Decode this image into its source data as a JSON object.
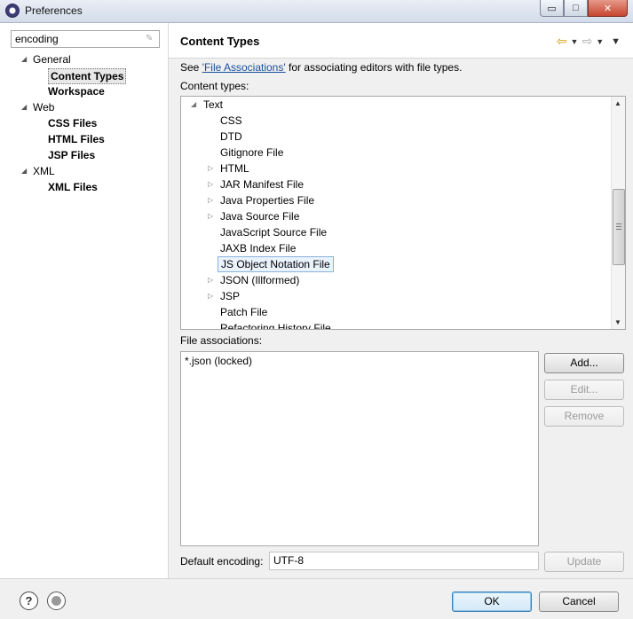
{
  "window": {
    "title": "Preferences",
    "minimize": "▭",
    "maximize": "□",
    "close": "✕"
  },
  "filter": {
    "value": "encoding"
  },
  "tree": [
    {
      "label": "General",
      "level": 0,
      "expanded": true,
      "bold": false
    },
    {
      "label": "Content Types",
      "level": 1,
      "bold": true,
      "selected": true
    },
    {
      "label": "Workspace",
      "level": 1,
      "bold": true
    },
    {
      "label": "Web",
      "level": 0,
      "expanded": true,
      "bold": false
    },
    {
      "label": "CSS Files",
      "level": 1,
      "bold": true
    },
    {
      "label": "HTML Files",
      "level": 1,
      "bold": true
    },
    {
      "label": "JSP Files",
      "level": 1,
      "bold": true
    },
    {
      "label": "XML",
      "level": 0,
      "expanded": true,
      "bold": false
    },
    {
      "label": "XML Files",
      "level": 1,
      "bold": true
    }
  ],
  "page": {
    "title": "Content Types",
    "info_prefix": "See ",
    "info_link": "'File Associations'",
    "info_suffix": " for associating editors with file types.",
    "content_types_label": "Content types:",
    "file_associations_label": "File associations:",
    "default_encoding_label": "Default encoding:",
    "default_encoding_value": "UTF-8"
  },
  "content_types": [
    {
      "label": "Text",
      "level": 0,
      "twisty": "expanded"
    },
    {
      "label": "CSS",
      "level": 1,
      "twisty": "none"
    },
    {
      "label": "DTD",
      "level": 1,
      "twisty": "none"
    },
    {
      "label": "Gitignore File",
      "level": 1,
      "twisty": "none"
    },
    {
      "label": "HTML",
      "level": 1,
      "twisty": "collapsed"
    },
    {
      "label": "JAR Manifest File",
      "level": 1,
      "twisty": "collapsed"
    },
    {
      "label": "Java Properties File",
      "level": 1,
      "twisty": "collapsed"
    },
    {
      "label": "Java Source File",
      "level": 1,
      "twisty": "collapsed"
    },
    {
      "label": "JavaScript Source File",
      "level": 1,
      "twisty": "none"
    },
    {
      "label": "JAXB Index File",
      "level": 1,
      "twisty": "none"
    },
    {
      "label": "JS Object Notation File",
      "level": 1,
      "twisty": "none",
      "selected": true
    },
    {
      "label": "JSON (Illformed)",
      "level": 1,
      "twisty": "collapsed"
    },
    {
      "label": "JSP",
      "level": 1,
      "twisty": "collapsed"
    },
    {
      "label": "Patch File",
      "level": 1,
      "twisty": "none"
    },
    {
      "label": "Refactoring History File",
      "level": 1,
      "twisty": "none"
    }
  ],
  "file_associations": [
    "*.json (locked)"
  ],
  "buttons": {
    "add": "Add...",
    "edit": "Edit...",
    "remove": "Remove",
    "update": "Update",
    "ok": "OK",
    "cancel": "Cancel",
    "help": "?"
  },
  "colors": {
    "link": "#1a4f9c",
    "selection_border": "#8ab2de",
    "back_arrow": "#d59a00"
  }
}
